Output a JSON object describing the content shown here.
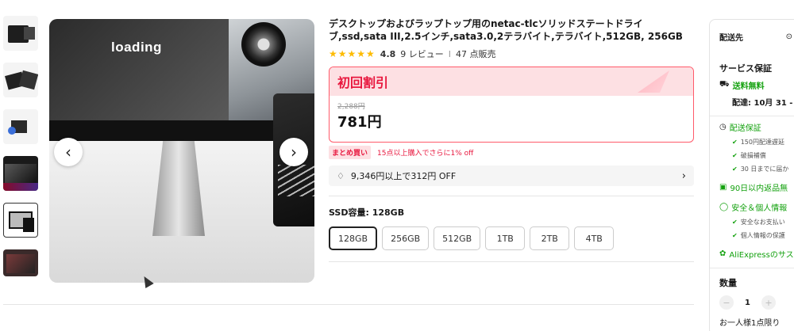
{
  "gallery": {
    "loading_text": "loading",
    "prev_arrow": "‹",
    "next_arrow": "›"
  },
  "product": {
    "title": "デスクトップおよびラップトップ用のnetac-tlcソリッドステートドライブ,ssd,sata III,2.5インチ,sata3.0,2テラバイト,テラバイト,512GB, 256GB",
    "rating": "4.8",
    "stars": "★★★★★",
    "reviews": "9 レビュー",
    "separator": "I",
    "sold": "47 点販売"
  },
  "promo": {
    "label": "初回割引",
    "old_price": "2,288円",
    "new_price": "781円",
    "colors": {
      "accent": "#e8173e",
      "bg": "#fde0e3"
    }
  },
  "bundle": {
    "badge": "まとめ買い",
    "text": "15点以上購入でさらに1% off"
  },
  "coupon": {
    "text": "9,346円以上で312円 OFF",
    "chevron": "›"
  },
  "variant": {
    "label": "SSD容量: 128GB",
    "options": [
      "128GB",
      "256GB",
      "512GB",
      "1TB",
      "2TB",
      "4TB"
    ],
    "selected": "128GB"
  },
  "side": {
    "ship_to": "配送先",
    "loc_icon": "⊙",
    "service_title": "サービス保証",
    "free_shipping": "送料無料",
    "delivery": "配達: 10月 31 -",
    "delivery_guarantee": "配送保証",
    "dg_items": [
      "150円配達遅延",
      "破損補償",
      "30 日までに届か"
    ],
    "returns": "90日以内返品無",
    "safety": "安全＆個人情報",
    "safety_items": [
      "安全なお支払い",
      "個人情報の保護"
    ],
    "aliexpress": "AliExpressのサス",
    "qty_title": "数量",
    "qty_minus": "−",
    "qty_value": "1",
    "qty_plus": "+",
    "limit": "お一人様1点限り"
  }
}
